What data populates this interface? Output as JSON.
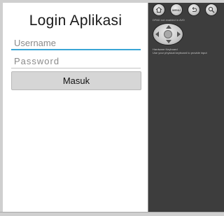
{
  "app": {
    "title": "Login Aplikasi",
    "username_placeholder": "Username",
    "password_placeholder": "Password",
    "login_button": "Masuk"
  },
  "emulator": {
    "home_icon": "home-icon",
    "menu_label": "MENU",
    "back_icon": "back-icon",
    "search_icon": "search-icon",
    "dpad_label": "DPAD not enabled in AVD",
    "keyboard_title": "Hardware Keyboard",
    "keyboard_desc": "Use your physical keyboard to provide input"
  },
  "colors": {
    "accent": "#3aa6d6",
    "panel": "#3d3d3d",
    "button": "#d6d6d6"
  }
}
